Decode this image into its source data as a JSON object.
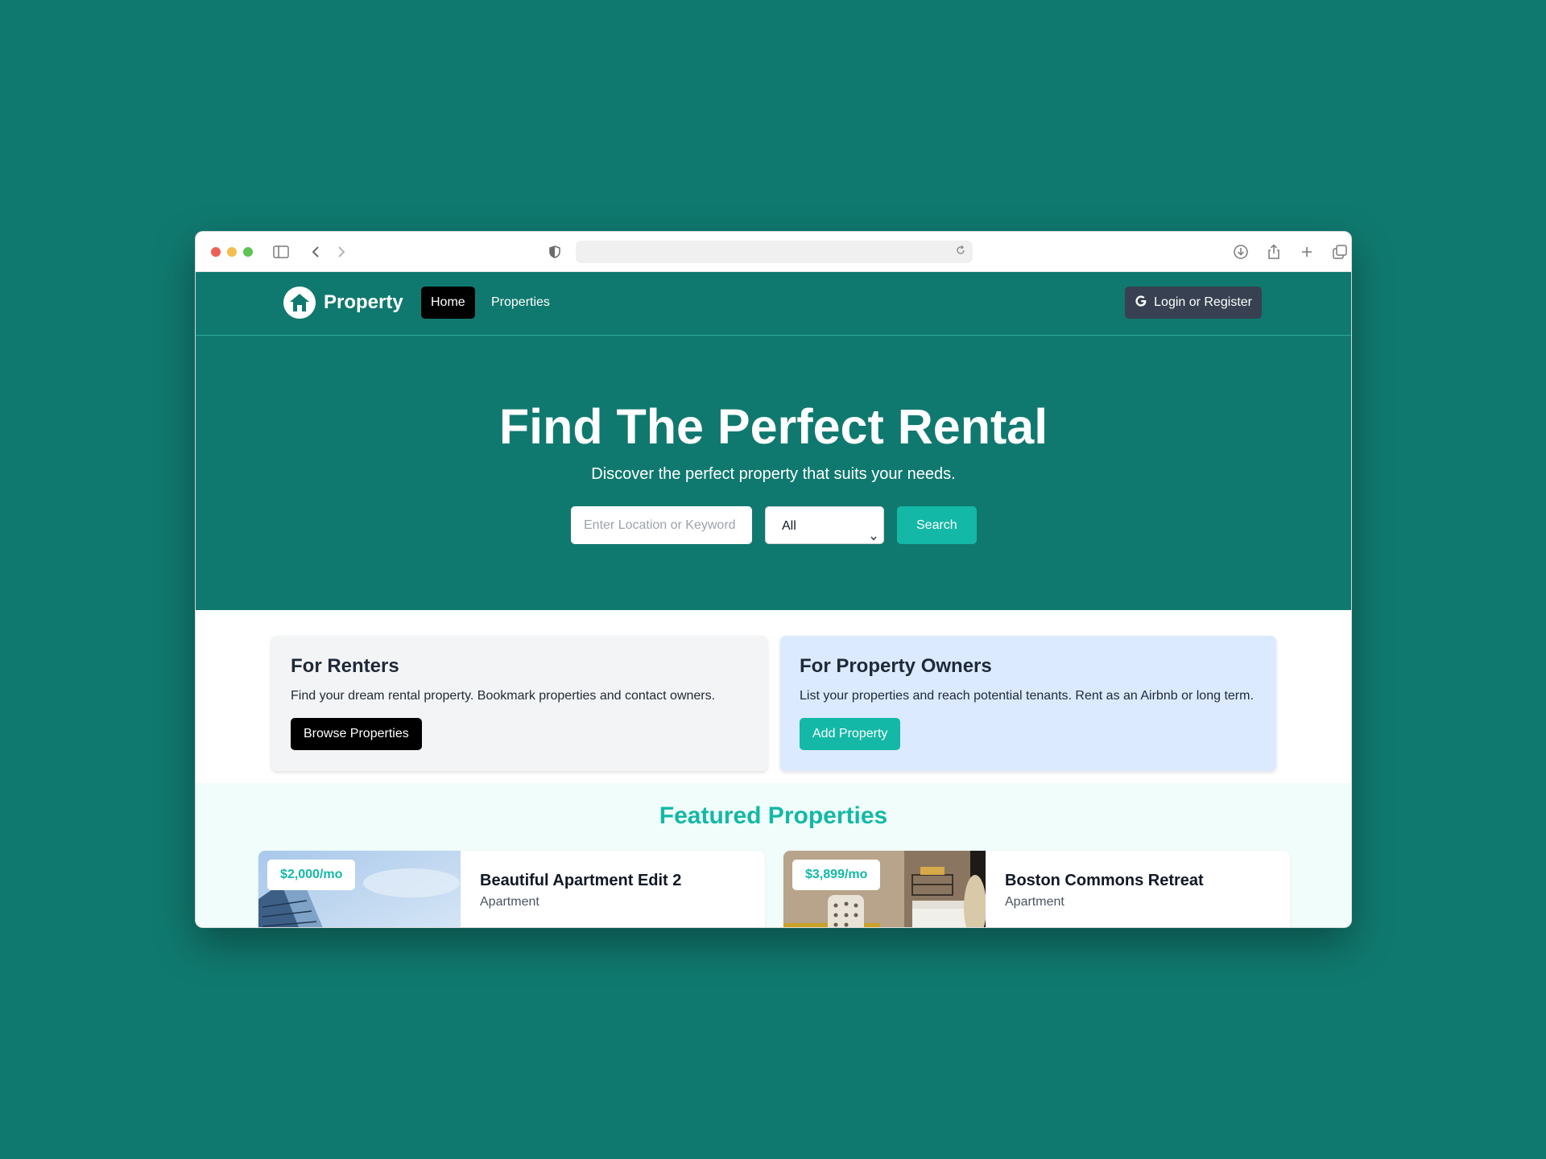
{
  "navbar": {
    "brand": "Property",
    "links": [
      {
        "label": "Home",
        "active": true
      },
      {
        "label": "Properties",
        "active": false
      }
    ],
    "login_label": "Login or Register"
  },
  "hero": {
    "title": "Find The Perfect Rental",
    "subtitle": "Discover the perfect property that suits your needs.",
    "search_placeholder": "Enter Location or Keyword",
    "type_selected": "All",
    "search_button": "Search"
  },
  "info_cards": {
    "renters": {
      "title": "For Renters",
      "text": "Find your dream rental property. Bookmark properties and contact owners.",
      "button": "Browse Properties"
    },
    "owners": {
      "title": "For Property Owners",
      "text": "List your properties and reach potential tenants. Rent as an Airbnb or long term.",
      "button": "Add Property"
    }
  },
  "featured": {
    "title": "Featured Properties",
    "properties": [
      {
        "price": "$2,000/mo",
        "name": "Beautiful Apartment Edit 2",
        "type": "Apartment"
      },
      {
        "price": "$3,899/mo",
        "name": "Boston Commons Retreat",
        "type": "Apartment"
      }
    ]
  },
  "colors": {
    "background": "#10796f",
    "accent": "#14b8a6",
    "dark_button": "#000000",
    "login_button": "#374151"
  },
  "icons": {
    "sidebar": "sidebar-icon",
    "back": "chevron-left-icon",
    "forward": "chevron-right-icon",
    "shield": "shield-icon",
    "reload": "reload-icon",
    "download": "download-icon",
    "share": "share-icon",
    "new_tab": "plus-icon",
    "tabs": "tabs-icon",
    "logo": "house-icon",
    "google": "google-icon"
  }
}
